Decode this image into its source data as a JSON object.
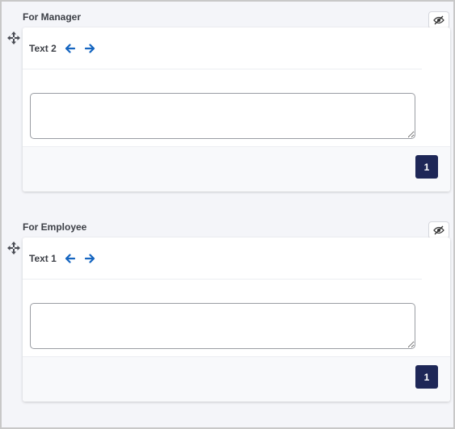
{
  "sections": [
    {
      "title": "For Manager",
      "text_label": "Text 2",
      "textarea_value": "",
      "page_number": "1"
    },
    {
      "title": "For Employee",
      "text_label": "Text 1",
      "textarea_value": "",
      "page_number": "1"
    }
  ],
  "icons": {
    "visibility": "eye-slash-icon",
    "move": "move-arrows-icon",
    "prev": "arrow-left-icon",
    "next": "arrow-right-icon"
  },
  "colors": {
    "accent_arrow": "#1565c0",
    "page_badge": "#1e2757",
    "background": "#f4f5f9"
  }
}
